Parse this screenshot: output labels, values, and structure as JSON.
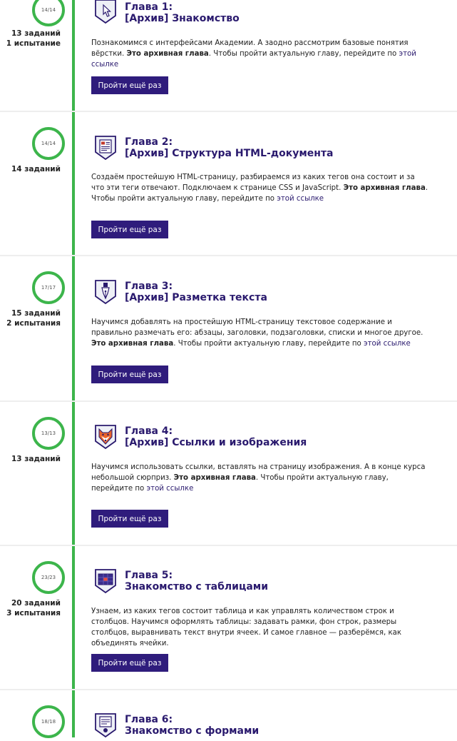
{
  "chapters": [
    {
      "progress": "14/14",
      "tasks": "13 заданий",
      "tests": "1 испытание",
      "title_line1": "Глава 1:",
      "title_line2": "[Архив] Знакомство",
      "desc_text": "Познакомимся с интерфейсами Академии. А заодно рассмотрим базовые понятия вёрстки.",
      "archive_bold": "Это архивная глава",
      "archive_text": ". Чтобы пройти актуальную главу, перейдите по",
      "link_text": "этой ссылке",
      "button_label": "Пройти ещё раз",
      "icon": "cursor-hand-icon"
    },
    {
      "progress": "14/14",
      "tasks": "14 заданий",
      "tests": "",
      "title_line1": "Глава 2:",
      "title_line2": "[Архив] Структура HTML-документа",
      "desc_text": "Создаём простейшую HTML-страницу, разбираемся из каких тегов она состоит и за что эти теги отвечают. Подключаем к странице CSS и JavaScript.",
      "archive_bold": "Это архивная глава",
      "archive_text": ". Чтобы пройти актуальную главу, перейдите по",
      "link_text": "этой ссылке",
      "button_label": "Пройти ещё раз",
      "icon": "document-icon"
    },
    {
      "progress": "17/17",
      "tasks": "15 заданий",
      "tests": "2 испытания",
      "title_line1": "Глава 3:",
      "title_line2": "[Архив] Разметка текста",
      "desc_text": "Научимся добавлять на простейшую HTML-страницу текстовое содержание и правильно размечать его: абзацы, заголовки, подзаголовки, списки и многое другое.",
      "archive_bold": "Это архивная глава",
      "archive_text": ". Чтобы пройти актуальную главу, перейдите по",
      "link_text": "этой ссылке",
      "button_label": "Пройти ещё раз",
      "icon": "pen-nib-icon"
    },
    {
      "progress": "13/13",
      "tasks": "13 заданий",
      "tests": "",
      "title_line1": "Глава 4:",
      "title_line2": "[Архив] Ссылки и изображения",
      "desc_text": "Научимся использовать ссылки, вставлять на страницу изображения. А в конце курса небольшой сюрприз.",
      "archive_bold": "Это архивная глава",
      "archive_text": ". Чтобы пройти актуальную главу, перейдите по",
      "link_text": "этой ссылке",
      "button_label": "Пройти ещё раз",
      "icon": "fox-icon"
    },
    {
      "progress": "23/23",
      "tasks": "20 заданий",
      "tests": "3 испытания",
      "title_line1": "Глава 5:",
      "title_line2": "Знакомство с таблицами",
      "desc_text": "Узнаем, из каких тегов состоит таблица и как управлять количеством строк и столбцов. Научимся оформлять таблицы: задавать рамки, фон строк, размеры столбцов, выравнивать текст внутри ячеек. И самое главное — разберёмся, как объединять ячейки.",
      "archive_bold": "",
      "archive_text": "",
      "link_text": "",
      "button_label": "Пройти ещё раз",
      "icon": "table-icon"
    },
    {
      "progress": "18/18",
      "tasks": "",
      "tests": "",
      "title_line1": "Глава 6:",
      "title_line2": "Знакомство с формами",
      "desc_text": "",
      "archive_bold": "",
      "archive_text": "",
      "link_text": "",
      "button_label": "",
      "icon": "form-icon"
    }
  ],
  "colors": {
    "timeline_green": "#3cb54b",
    "title_purple": "#2a1a6e",
    "button_purple": "#2f1c7c"
  }
}
